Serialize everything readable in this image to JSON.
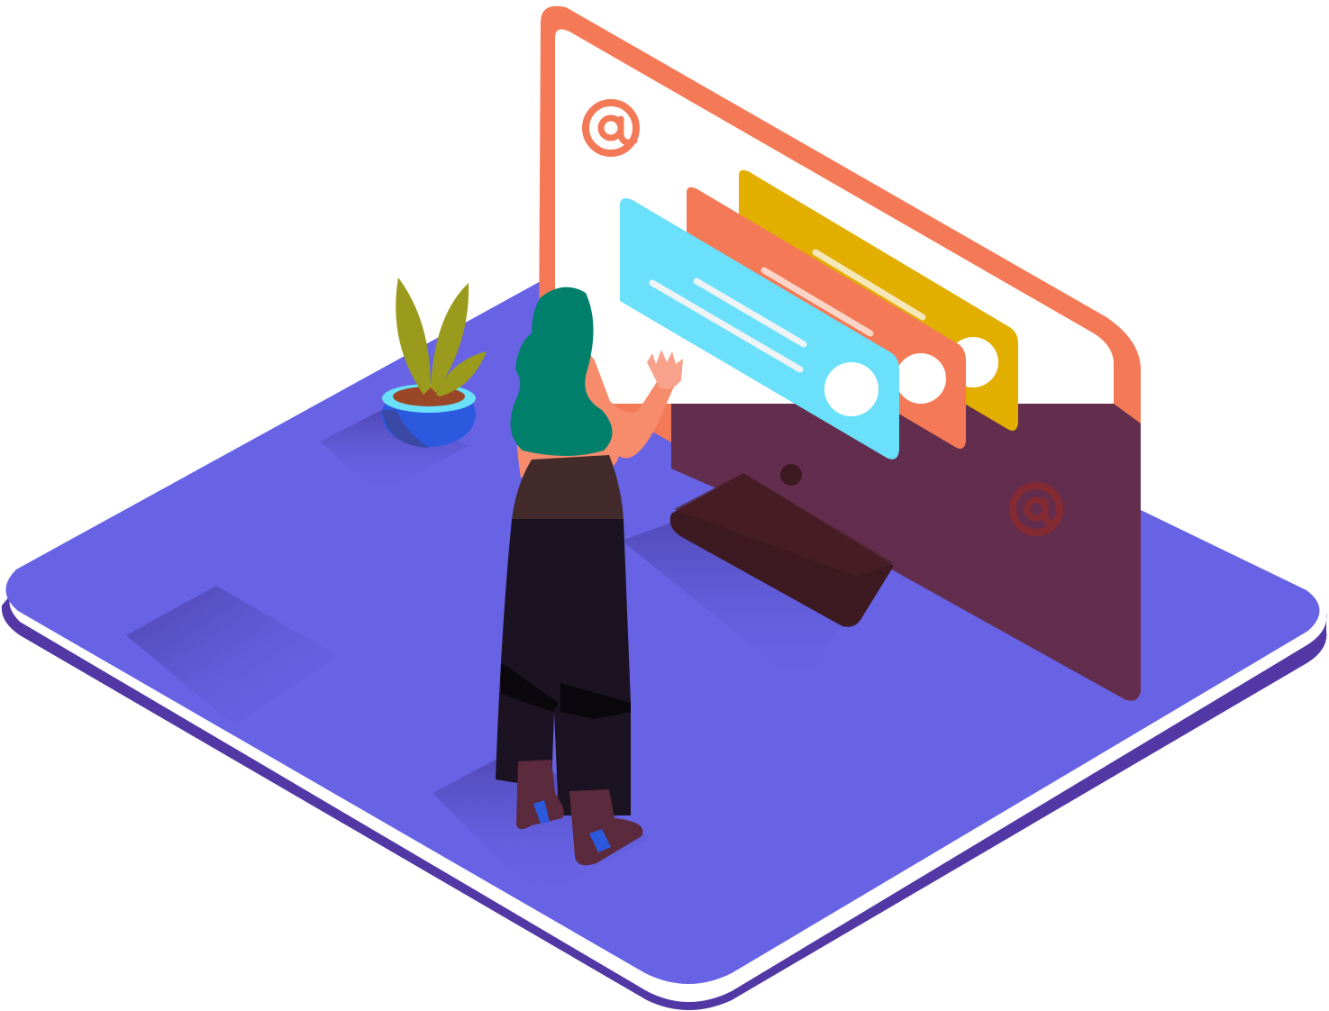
{
  "illustration": {
    "subject": "woman-at-email-monitor",
    "icons": {
      "top_email": "at-sign-icon",
      "bottom_email": "at-sign-icon"
    },
    "message_cards": [
      {
        "name": "message-card-blue",
        "color": "#6AE0FB",
        "lines": 2
      },
      {
        "name": "message-card-orange",
        "color": "#F47A57",
        "lines": 1
      },
      {
        "name": "message-card-yellow",
        "color": "#E2AE00",
        "lines": 1
      }
    ],
    "at_glyph": "@",
    "colors": {
      "floor": "#6763E4",
      "floor_edge": "#5338A5",
      "monitor_frame": "#F47A57",
      "monitor_screen": "#FFFFFF",
      "monitor_back_shade": "#632D4E",
      "hair": "#00806B",
      "skin": "#F68C6C",
      "top": "#432A2B",
      "trousers": "#1C1322",
      "boots": "#5B2A3C",
      "plant_leaf": "#9A9B1C",
      "plant_pot": "#2C59DE",
      "pot_soil": "#9A4728"
    }
  }
}
